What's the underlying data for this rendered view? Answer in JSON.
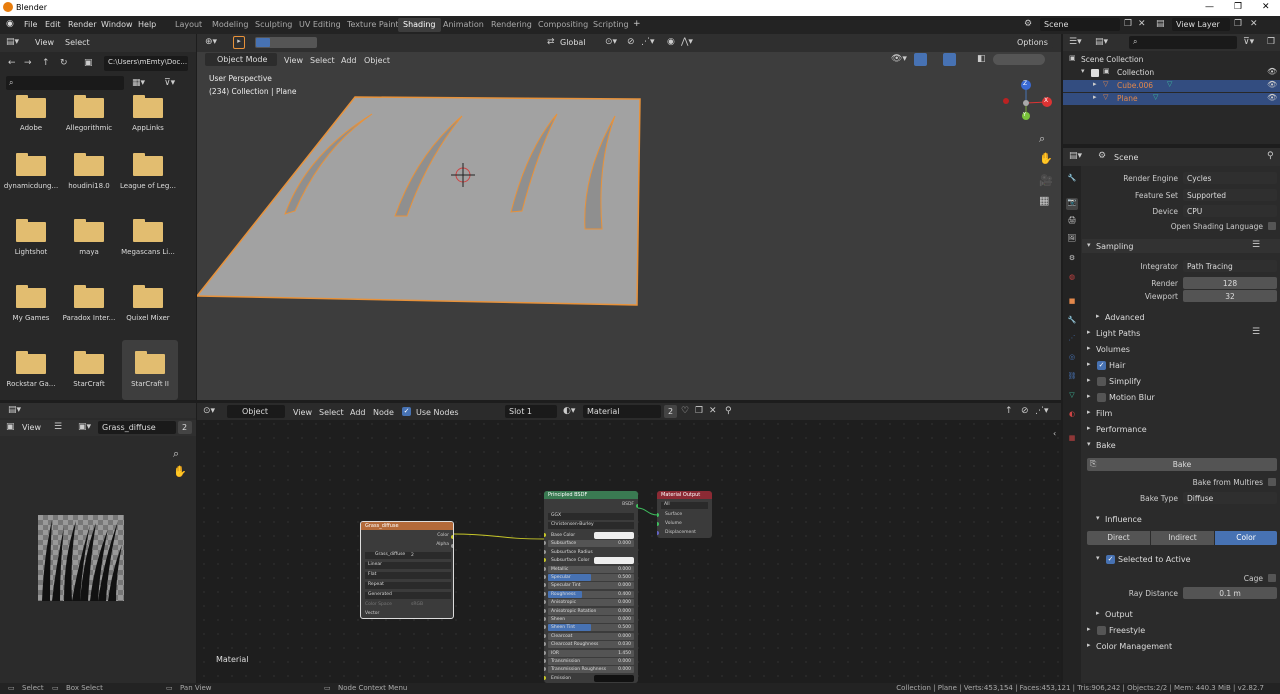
{
  "window": {
    "title": "Blender"
  },
  "menubar": {
    "items": [
      "File",
      "Edit",
      "Render",
      "Window",
      "Help"
    ]
  },
  "workspaces": [
    "Layout",
    "Modeling",
    "Sculpting",
    "UV Editing",
    "Texture Paint",
    "Shading",
    "Animation",
    "Rendering",
    "Compositing",
    "Scripting"
  ],
  "active_workspace": "Shading",
  "scene_field": "Scene",
  "viewlayer_field": "View Layer",
  "filebrowser": {
    "menus": [
      "View",
      "Select"
    ],
    "path": "C:\\Users\\mEmty\\Doc...",
    "folders": [
      "Adobe",
      "Allegorithmic",
      "AppLinks",
      "dynamicdung...",
      "houdini18.0",
      "League of Leg...",
      "Lightshot",
      "maya",
      "Megascans Li...",
      "My Games",
      "Paradox Inter...",
      "Quixel Mixer",
      "Rockstar Ga...",
      "StarCraft",
      "StarCraft II"
    ]
  },
  "viewport": {
    "mode": "Object Mode",
    "menus": [
      "View",
      "Select",
      "Add",
      "Object"
    ],
    "transform_orientation": "Global",
    "options": "Options",
    "overlay_line1": "User Perspective",
    "overlay_line2": "(234) Collection | Plane",
    "gizmo_x": "X",
    "gizmo_y": "Y",
    "gizmo_z": "Z"
  },
  "image_editor": {
    "menu": "View",
    "image_name": "Grass_diffuse",
    "users": "2"
  },
  "node_editor": {
    "type": "Object",
    "menus": [
      "View",
      "Select",
      "Add",
      "Node"
    ],
    "use_nodes_label": "Use Nodes",
    "slot": "Slot 1",
    "material": "Material",
    "users": "2",
    "footer_label": "Material",
    "image_node": {
      "title": "Grass_diffuse",
      "outputs": [
        "Color",
        "Alpha"
      ],
      "image": "Grass_diffuse",
      "users": "2",
      "options": [
        "Linear",
        "Flat",
        "Repeat",
        "Generated"
      ],
      "color_space_label": "Color Space",
      "color_space": "sRGB",
      "vector": "Vector"
    },
    "bsdf_node": {
      "title": "Principled BSDF",
      "output": "BSDF",
      "distribution": "GGX",
      "subsurface_method": "Christensen-Burley",
      "rows": [
        {
          "label": "Base Color",
          "value": ""
        },
        {
          "label": "Subsurface",
          "value": "0.000"
        },
        {
          "label": "Subsurface Radius",
          "value": ""
        },
        {
          "label": "Subsurface Color",
          "value": ""
        },
        {
          "label": "Metallic",
          "value": "0.000"
        },
        {
          "label": "Specular",
          "value": "0.500"
        },
        {
          "label": "Specular Tint",
          "value": "0.000"
        },
        {
          "label": "Roughness",
          "value": "0.400"
        },
        {
          "label": "Anisotropic",
          "value": "0.000"
        },
        {
          "label": "Anisotropic Rotation",
          "value": "0.000"
        },
        {
          "label": "Sheen",
          "value": "0.000"
        },
        {
          "label": "Sheen Tint",
          "value": "0.500"
        },
        {
          "label": "Clearcoat",
          "value": "0.000"
        },
        {
          "label": "Clearcoat Roughness",
          "value": "0.030"
        },
        {
          "label": "IOR",
          "value": "1.450"
        },
        {
          "label": "Transmission",
          "value": "0.000"
        },
        {
          "label": "Transmission Roughness",
          "value": "0.000"
        },
        {
          "label": "Emission",
          "value": ""
        }
      ]
    },
    "output_node": {
      "title": "Material Output",
      "target": "All",
      "inputs": [
        "Surface",
        "Volume",
        "Displacement"
      ]
    }
  },
  "outliner": {
    "search_placeholder": "",
    "items": [
      {
        "label": "Scene Collection",
        "level": 0,
        "color": "#ddd"
      },
      {
        "label": "Collection",
        "level": 1,
        "color": "#ddd"
      },
      {
        "label": "Cube.006",
        "level": 2,
        "color": "#e3884b"
      },
      {
        "label": "Plane",
        "level": 2,
        "color": "#e3884b"
      }
    ]
  },
  "properties": {
    "context": "Scene",
    "render_engine_label": "Render Engine",
    "render_engine": "Cycles",
    "feature_set_label": "Feature Set",
    "feature_set": "Supported",
    "device_label": "Device",
    "device": "CPU",
    "osl_label": "Open Shading Language",
    "sampling": "Sampling",
    "integrator_label": "Integrator",
    "integrator": "Path Tracing",
    "render_label": "Render",
    "render_samples": "128",
    "viewport_label": "Viewport",
    "viewport_samples": "32",
    "advanced": "Advanced",
    "light_paths": "Light Paths",
    "volumes": "Volumes",
    "hair": "Hair",
    "simplify": "Simplify",
    "motion_blur": "Motion Blur",
    "film": "Film",
    "performance": "Performance",
    "bake": "Bake",
    "bake_button": "Bake",
    "bake_multires_label": "Bake from Multires",
    "bake_type_label": "Bake Type",
    "bake_type": "Diffuse",
    "influence": "Influence",
    "influence_tabs": [
      "Direct",
      "Indirect",
      "Color"
    ],
    "selected_to_active": "Selected to Active",
    "cage_label": "Cage",
    "ray_distance_label": "Ray Distance",
    "ray_distance": "0.1 m",
    "output": "Output",
    "freestyle": "Freestyle",
    "color_management": "Color Management"
  },
  "statusbar": {
    "select": "Select",
    "box_select": "Box Select",
    "pan_view": "Pan View",
    "node_context": "Node Context Menu",
    "stats": "Collection | Plane | Verts:453,154 | Faces:453,121 | Tris:906,242 | Objects:2/2 | Mem: 440.3 MiB | v2.82.7"
  },
  "colors": {
    "accent": "#4772b3",
    "selection": "#e8923a",
    "bsdf_header": "#3a7a52",
    "output_header": "#8c2a34",
    "image_header": "#b36a3a"
  }
}
